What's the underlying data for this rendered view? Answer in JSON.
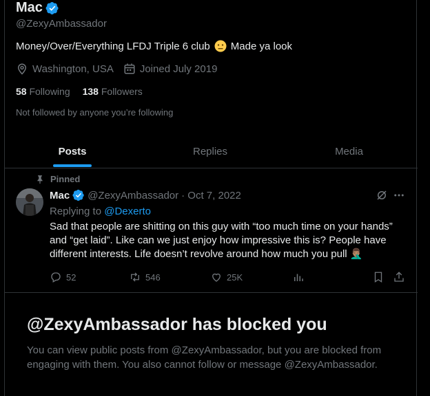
{
  "profile": {
    "name": "Mac",
    "handle": "@ZexyAmbassador",
    "bio_text": "Money/Over/Everything LFDJ Triple 6 club",
    "bio_tail": "Made ya look",
    "location": "Washington, USA",
    "joined": "Joined July 2019",
    "following_count": "58",
    "following_label": "Following",
    "followers_count": "138",
    "followers_label": "Followers",
    "not_followed_note": "Not followed by anyone you’re following"
  },
  "tabs": [
    {
      "label": "Posts",
      "active": true
    },
    {
      "label": "Replies",
      "active": false
    },
    {
      "label": "Media",
      "active": false
    }
  ],
  "tweet": {
    "pinned_label": "Pinned",
    "author": "Mac",
    "handle": "@ZexyAmbassador",
    "date": "· Oct 7, 2022",
    "replying_to_label": "Replying to",
    "replying_to": "@Dexerto",
    "text": "Sad that people are shitting on this guy with “too much time on your hands” and “get laid”. Like can we just enjoy how impressive this is? People have different interests. Life doesn’t revolve around how much you pull 🤦🏽‍♂️",
    "replies": "52",
    "reposts": "546",
    "likes": "25K"
  },
  "blocked": {
    "title": "@ZexyAmbassador has blocked you",
    "message": "You can view public posts from @ZexyAmbassador, but you are blocked from engaging with them. You also cannot follow or message @ZexyAmbassador."
  },
  "colors": {
    "accent": "#1d9bf0",
    "muted": "#71767b",
    "text": "#e7e9ea",
    "border": "#2f3336",
    "background": "#000000"
  }
}
